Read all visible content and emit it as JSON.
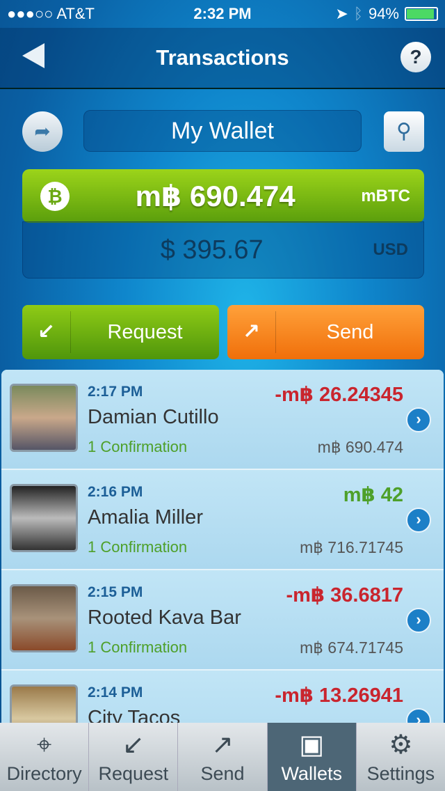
{
  "status": {
    "carrier": "●●●○○ AT&T",
    "time": "2:32 PM",
    "battery": "94%",
    "battery_level": 0.94
  },
  "nav": {
    "title": "Transactions",
    "help": "?"
  },
  "wallet": {
    "name": "My Wallet",
    "balance": "m฿ 690.474",
    "balance_unit": "mBTC",
    "fiat": "$ 395.67",
    "fiat_unit": "USD"
  },
  "actions": {
    "request": "Request",
    "send": "Send"
  },
  "transactions": [
    {
      "time": "2:17 PM",
      "name": "Damian Cutillo",
      "status": "1 Confirmation",
      "amount": "-m฿ 26.24345",
      "balance": "m฿ 690.474",
      "type": "neg"
    },
    {
      "time": "2:16 PM",
      "name": "Amalia Miller",
      "status": "1 Confirmation",
      "amount": "m฿ 42",
      "balance": "m฿ 716.71745",
      "type": "pos"
    },
    {
      "time": "2:15 PM",
      "name": "Rooted Kava Bar",
      "status": "1 Confirmation",
      "amount": "-m฿ 36.6817",
      "balance": "m฿ 674.71745",
      "type": "neg"
    },
    {
      "time": "2:14 PM",
      "name": "City Tacos",
      "status": "",
      "amount": "-m฿ 13.26941",
      "balance": "",
      "type": "neg"
    }
  ],
  "tabs": [
    {
      "label": "Directory",
      "icon": "map-pin-icon"
    },
    {
      "label": "Request",
      "icon": "arrow-down-left-icon"
    },
    {
      "label": "Send",
      "icon": "arrow-up-right-icon"
    },
    {
      "label": "Wallets",
      "icon": "wallet-icon",
      "active": true
    },
    {
      "label": "Settings",
      "icon": "gear-icon"
    }
  ]
}
